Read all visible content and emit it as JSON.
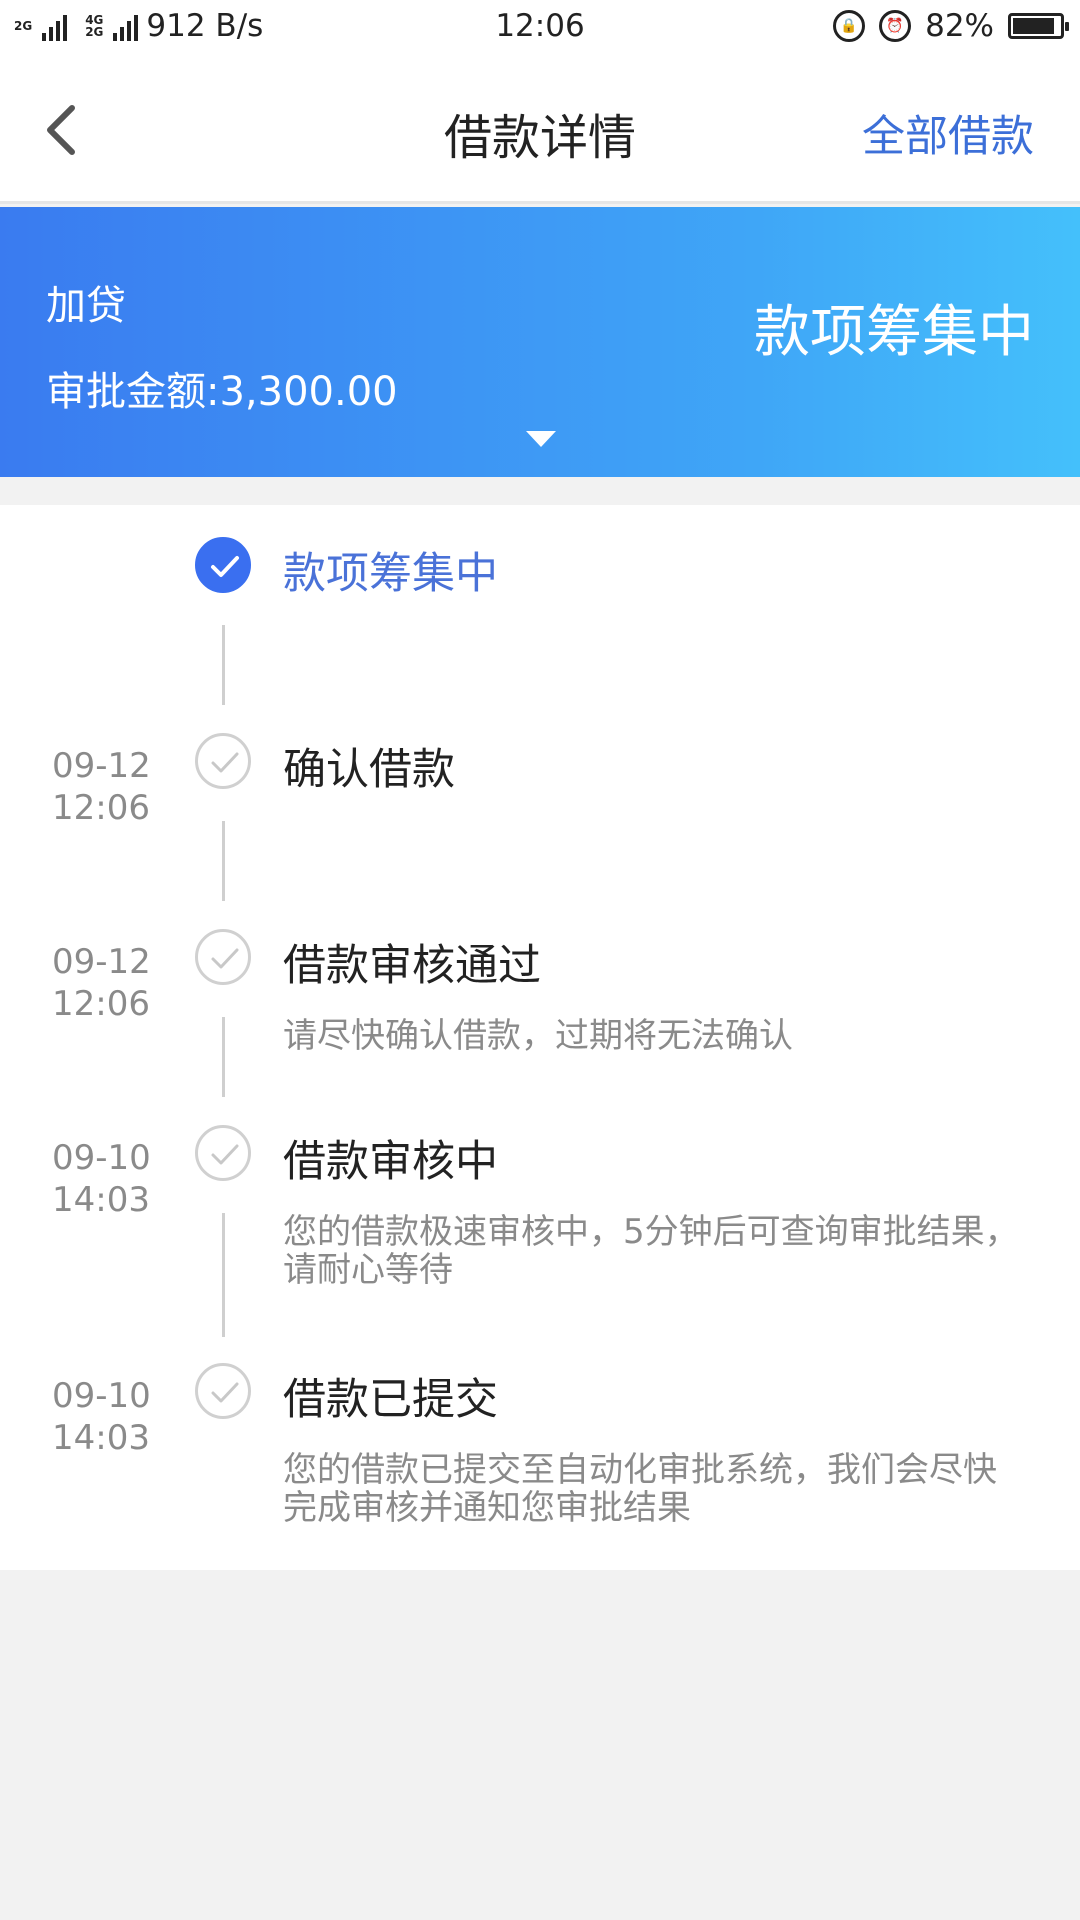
{
  "status_bar": {
    "network_small_top": "2G",
    "network_small_top2": "4G",
    "network_small_bottom2": "2G",
    "speed": "912 B/s",
    "time": "12:06",
    "battery": "82%"
  },
  "header": {
    "title": "借款详情",
    "right_link": "全部借款"
  },
  "banner": {
    "loan_type": "加贷",
    "approved_amount": "审批金额:3,300.00",
    "status": "款项筹集中"
  },
  "timeline": [
    {
      "date": "",
      "time": "",
      "title": "款项筹集中",
      "desc": "",
      "active": true
    },
    {
      "date": "09-12",
      "time": "12:06",
      "title": "确认借款",
      "desc": "",
      "active": false
    },
    {
      "date": "09-12",
      "time": "12:06",
      "title": "借款审核通过",
      "desc": "请尽快确认借款，过期将无法确认",
      "active": false
    },
    {
      "date": "09-10",
      "time": "14:03",
      "title": "借款审核中",
      "desc": "您的借款极速审核中，5分钟后可查询审批结果，请耐心等待",
      "active": false
    },
    {
      "date": "09-10",
      "time": "14:03",
      "title": "借款已提交",
      "desc": "您的借款已提交至自动化审批系统，我们会尽快完成审核并通知您审批结果",
      "active": false
    }
  ],
  "colors": {
    "accent": "#3a6ff0",
    "link": "#3c6fd8",
    "banner_start": "#3a7bf0",
    "banner_end": "#44c0fb"
  }
}
